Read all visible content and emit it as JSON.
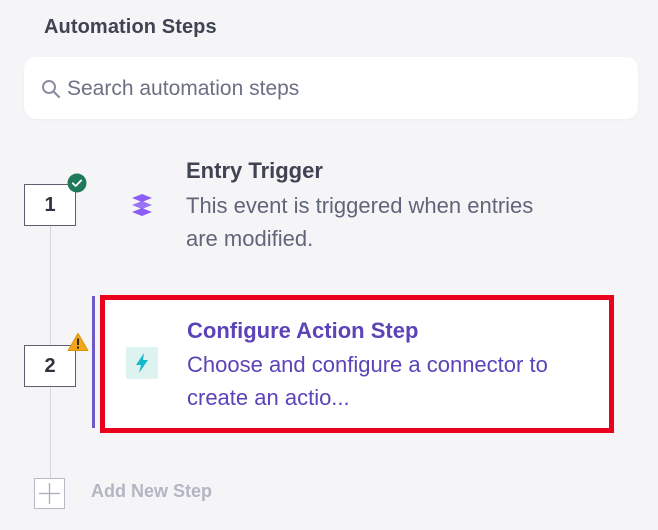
{
  "panel": {
    "title": "Automation Steps"
  },
  "search": {
    "placeholder": "Search automation steps",
    "icon": "search-icon"
  },
  "steps": [
    {
      "number": "1",
      "status": "complete",
      "status_icon": "check-circle-icon",
      "status_color": "#1f7a5a",
      "icon": "stack-icon",
      "icon_color": "#8b5cf6",
      "title": "Entry Trigger",
      "description": "This event is triggered when entries are modified."
    },
    {
      "number": "2",
      "status": "warning",
      "status_icon": "warning-triangle-icon",
      "status_color": "#f2a51a",
      "icon": "lightning-icon",
      "icon_color": "#0ea5b7",
      "title": "Configure Action Step",
      "description": "Choose and configure a connector to create an actio...",
      "active": true
    }
  ],
  "add_step": {
    "label": "Add New Step",
    "icon": "plus-icon"
  },
  "colors": {
    "accent": "#6f59c8",
    "highlight": "#e8001c"
  }
}
